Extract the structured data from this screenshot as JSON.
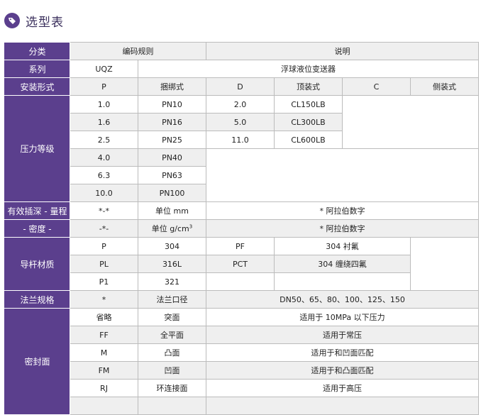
{
  "header": {
    "title": "选型表",
    "icon": "tag-icon",
    "accent": "#5b3f8d"
  },
  "table": {
    "r1": {
      "label": "分类",
      "c1": "编码规则",
      "c2": "说明"
    },
    "r2": {
      "label": "系列",
      "c1": "UQZ",
      "c2": "浮球液位变送器"
    },
    "r3": {
      "label": "安装形式",
      "c1": "P",
      "c2": "捆绑式",
      "c3": "D",
      "c4": "顶装式",
      "c5": "C",
      "c6": "侧装式"
    },
    "pressure": {
      "label": "压力等级",
      "rows": [
        {
          "a": "1.0",
          "b": "PN10",
          "c": "2.0",
          "d": "CL150LB"
        },
        {
          "a": "1.6",
          "b": "PN16",
          "c": "5.0",
          "d": "CL300LB"
        },
        {
          "a": "2.5",
          "b": "PN25",
          "c": "11.0",
          "d": "CL600LB"
        },
        {
          "a": "4.0",
          "b": "PN40"
        },
        {
          "a": "6.3",
          "b": "PN63"
        },
        {
          "a": "10.0",
          "b": "PN100"
        }
      ]
    },
    "depth": {
      "label": "有效插深 - 量程",
      "code": "*-*",
      "unit": "单位 mm",
      "desc": "* 阿拉伯数字"
    },
    "density": {
      "label": "- 密度 -",
      "code": "-*-",
      "unit_main": "单位 g/cm",
      "unit_sup": "3",
      "desc": "* 阿拉伯数字"
    },
    "rod": {
      "label": "导杆材质",
      "rows": [
        {
          "a": "P",
          "b": "304",
          "c": "PF",
          "d": "304 衬氟"
        },
        {
          "a": "PL",
          "b": "316L",
          "c": "PCT",
          "d": "304 缠绕四氟"
        },
        {
          "a": "P1",
          "b": "321"
        }
      ]
    },
    "flange": {
      "label": "法兰规格",
      "code": "*",
      "name": "法兰口径",
      "desc": "DN50、65、80、100、125、150"
    },
    "seal": {
      "label": "密封面",
      "rows": [
        {
          "a": "省略",
          "b": "突面",
          "c": "适用于 10MPa 以下压力"
        },
        {
          "a": "FF",
          "b": "全平面",
          "c": "适用于常压"
        },
        {
          "a": "M",
          "b": "凸面",
          "c": "适用于和凹面匹配"
        },
        {
          "a": "FM",
          "b": "凹面",
          "c": "适用于和凸面匹配"
        },
        {
          "a": "RJ",
          "b": "环连接面",
          "c": "适用于高压"
        }
      ]
    }
  }
}
